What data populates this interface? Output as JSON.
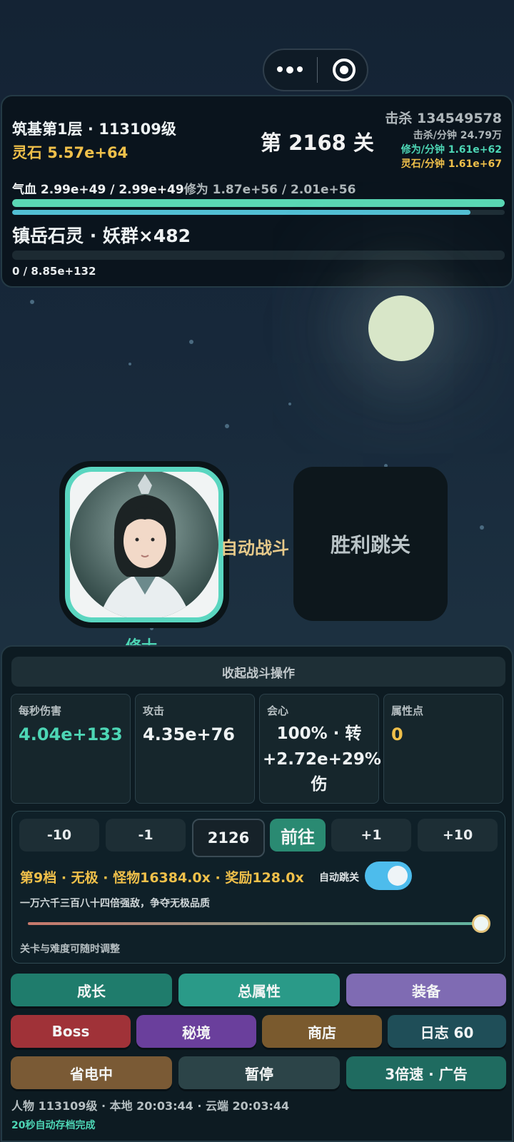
{
  "capsule": {
    "more_icon": "more-dots-icon",
    "target_icon": "record-target-icon"
  },
  "header": {
    "realm": "筑基第1层 · 113109级",
    "spirit_stones": "灵石 5.57e+64",
    "stage": "第 2168 关",
    "kills": "击杀 134549578",
    "kills_per_min": "击杀/分钟 24.79万",
    "cult_per_min": "修为/分钟 1.61e+62",
    "stones_per_min": "灵石/分钟 1.61e+67",
    "hp_text": "气血 2.99e+49 / 2.99e+49",
    "cult_text": "修为 1.87e+56 / 2.01e+56",
    "hp_fraction": 1.0,
    "cult_fraction": 0.93,
    "enemy": "镇岳石灵 · 妖群×482",
    "enemy_hp": "0 / 8.85e+132",
    "enemy_fraction": 0.0
  },
  "battle": {
    "hero_name": "修士",
    "auto_battle": "自动战斗",
    "victory_skip": "胜利跳关"
  },
  "panel": {
    "collapse_label": "收起战斗操作",
    "stats": [
      {
        "label": "每秒伤害",
        "value": "4.04e+133"
      },
      {
        "label": "攻击",
        "value": "4.35e+76"
      },
      {
        "label": "会心",
        "value": "100% · 转+2.72e+29%伤"
      },
      {
        "label": "属性点",
        "value": "0"
      }
    ],
    "stage_controls": {
      "minus10": "-10",
      "minus1": "-1",
      "stage_value": "2126",
      "go": "前往",
      "plus1": "+1",
      "plus10": "+10"
    },
    "tier_text": "第9档 · 无极 · 怪物16384.0x · 奖励128.0x",
    "auto_skip_label": "自动跳关",
    "auto_skip_on": true,
    "tier_desc": "一万六千三百八十四倍强敌，争夺无极品质",
    "slider_fraction": 1.0,
    "slider_note": "关卡与难度可随时调整"
  },
  "buttons": {
    "growth": "成长",
    "total_attr": "总属性",
    "equipment": "装备",
    "boss": "Boss",
    "secret_realm": "秘境",
    "shop": "商店",
    "log": "日志 60",
    "power_save": "省电中",
    "pause": "暂停",
    "speed_ad": "3倍速 · 广告"
  },
  "footer": {
    "status": "人物 113109级 · 本地 20:03:44 · 云端 20:03:44",
    "autosave": "20秒自动存档完成"
  },
  "colors": {
    "teal": "#4dd6b5",
    "gold": "#f0c04a",
    "growth_btn": "#1f7c6c",
    "attr_btn": "#2a9a88",
    "equip_btn": "#7f6bb3",
    "boss_btn": "#a03238",
    "realm_btn": "#6a3f9c",
    "shop_btn": "#7a5a2e",
    "log_btn": "#1f4e58",
    "power_btn": "#7a5a35",
    "pause_btn": "#2c4448",
    "speed_btn": "#1f6b60"
  }
}
